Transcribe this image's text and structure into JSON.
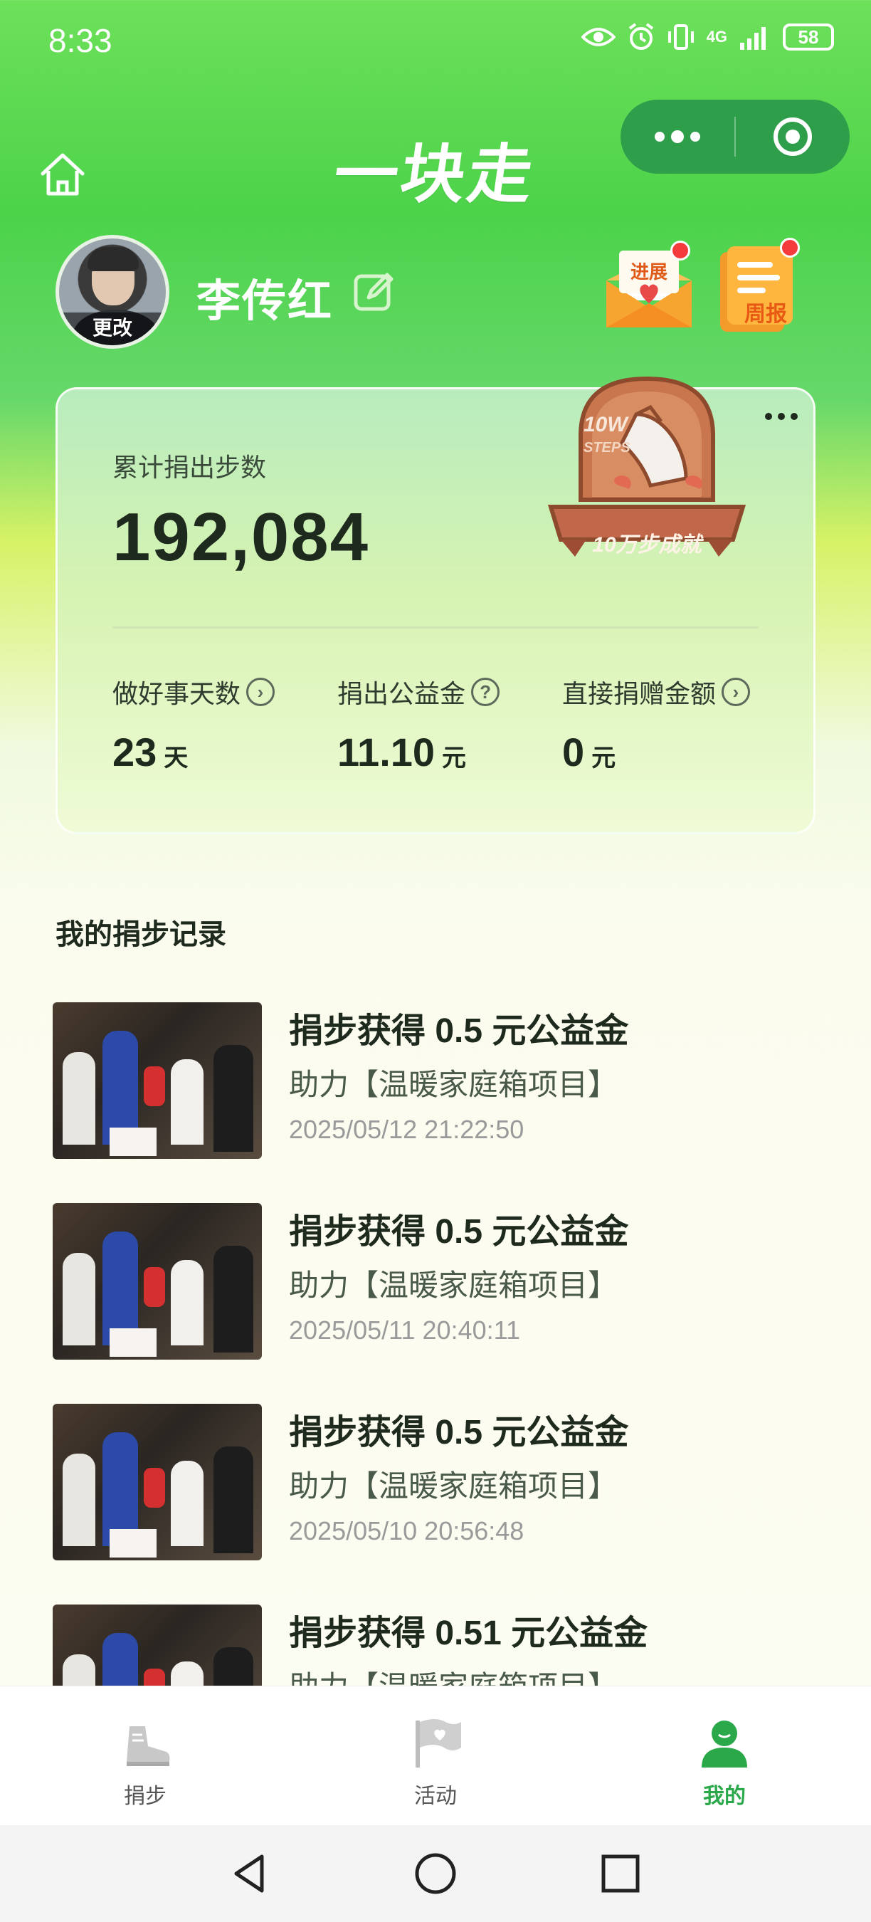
{
  "status_bar": {
    "time": "8:33",
    "network": "4G",
    "battery": "58"
  },
  "header": {
    "title": "一块走"
  },
  "profile": {
    "name": "李传红",
    "avatar_label": "更改"
  },
  "badges": {
    "progress_label": "进展",
    "weekly_label": "周报"
  },
  "stats": {
    "total_label": "累计捐出步数",
    "total_value": "192,084",
    "achievement_label": "10万步成就",
    "achievement_top": "10W",
    "achievement_sub": "STEPS",
    "items": [
      {
        "label": "做好事天数",
        "value": "23",
        "unit": "天",
        "icon": "chevron-right-icon"
      },
      {
        "label": "捐出公益金",
        "value": "11.10",
        "unit": "元",
        "icon": "question-icon"
      },
      {
        "label": "直接捐赠金额",
        "value": "0",
        "unit": "元",
        "icon": "chevron-right-icon"
      }
    ]
  },
  "records": {
    "title": "我的捐步记录",
    "items": [
      {
        "title": "捐步获得 0.5 元公益金",
        "project": "助力【温暖家庭箱项目】",
        "time": "2025/05/12 21:22:50"
      },
      {
        "title": "捐步获得 0.5 元公益金",
        "project": "助力【温暖家庭箱项目】",
        "time": "2025/05/11 20:40:11"
      },
      {
        "title": "捐步获得 0.5 元公益金",
        "project": "助力【温暖家庭箱项目】",
        "time": "2025/05/10 20:56:48"
      },
      {
        "title": "捐步获得 0.51 元公益金",
        "project": "助力【温暖家庭箱项目】",
        "time": ""
      }
    ]
  },
  "tabbar": {
    "items": [
      {
        "label": "捐步",
        "icon": "shoe-icon"
      },
      {
        "label": "活动",
        "icon": "flag-icon"
      },
      {
        "label": "我的",
        "icon": "person-icon",
        "active": true
      }
    ]
  },
  "colors": {
    "accent": "#2aa84a",
    "header_green": "#4cd34a",
    "capsule": "#2f9e4a"
  }
}
